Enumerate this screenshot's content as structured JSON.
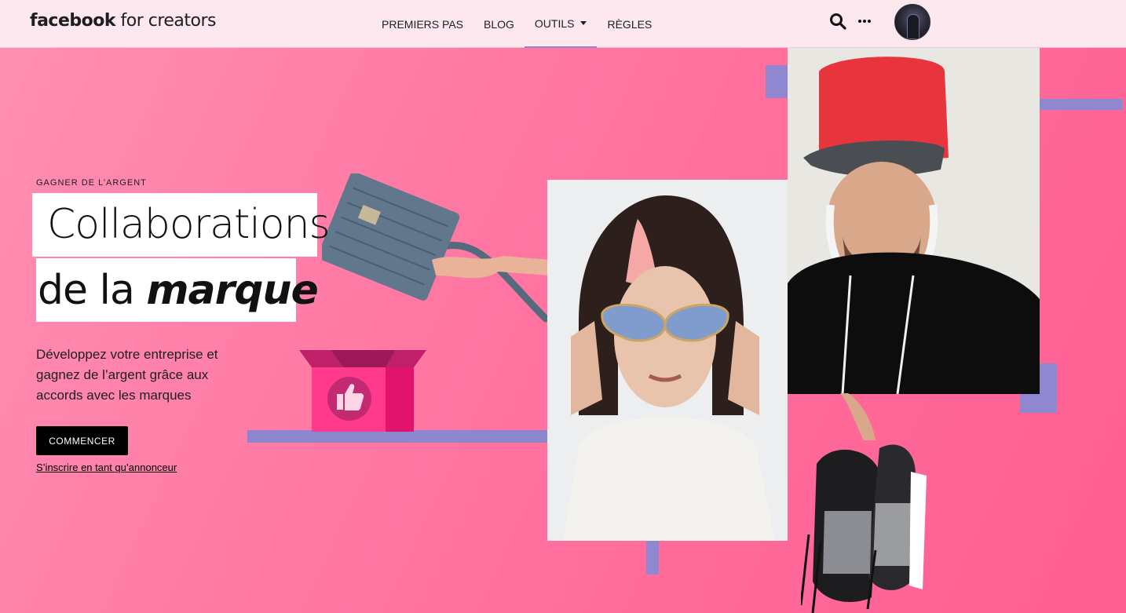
{
  "header": {
    "logo_bold": "facebook",
    "logo_light": " for creators",
    "nav": [
      {
        "label": "PREMIERS PAS"
      },
      {
        "label": "BLOG"
      },
      {
        "label": "OUTILS"
      },
      {
        "label": "RÈGLES"
      }
    ],
    "icons": [
      "search-icon",
      "more-icon",
      "avatar"
    ]
  },
  "hero": {
    "kicker": "GAGNER DE L’ARGENT",
    "title_line1": "Collaborations",
    "title_line2_prefix": "de la ",
    "title_line2_emphasis": "marque",
    "description": "Développez votre entreprise et gagnez de l’argent grâce aux accords avec les marques",
    "cta_label": "COMMENCER",
    "advertiser_link": "S’inscrire en tant qu’annonceur"
  },
  "colors": {
    "header_bg": "#fde8ef",
    "hero_pink": "#ff74a1",
    "accent_purple": "#8f88d0",
    "cta_bg": "#000000"
  }
}
